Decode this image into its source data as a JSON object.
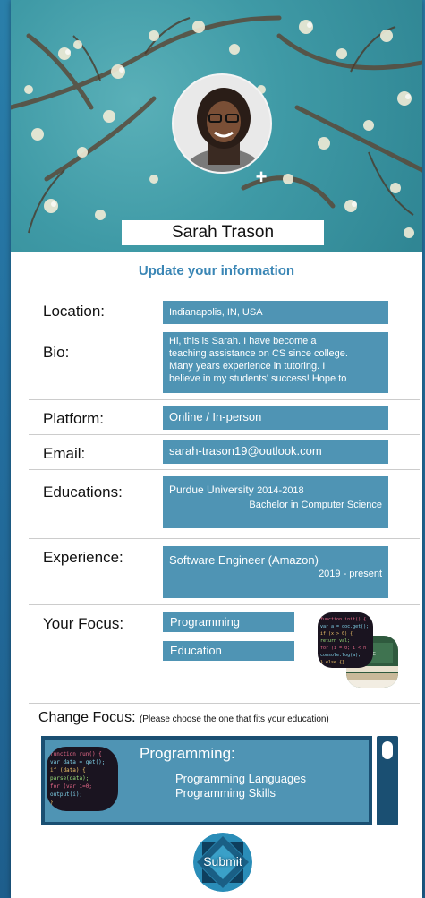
{
  "profile": {
    "name": "Sarah Trason",
    "add_photo_icon": "plus-icon"
  },
  "form": {
    "title": "Update your information",
    "location": {
      "label": "Location:",
      "value": "Indianapolis, IN, USA"
    },
    "bio": {
      "label": "Bio:",
      "lines": [
        "Hi, this is Sarah. I have become a",
        "teaching assistance on CS since college.",
        "Many years experience in tutoring. I",
        "believe in my students' success! Hope to"
      ]
    },
    "platform": {
      "label": "Platform:",
      "value": "Online / In-person"
    },
    "email": {
      "label": "Email:",
      "value": "sarah-trason19@outlook.com"
    },
    "education": {
      "label": "Educations:",
      "school": "Purdue University",
      "years": "2014-2018",
      "degree": "Bachelor in Computer Science"
    },
    "experience": {
      "label": "Experience:",
      "role": "Software Engineer (Amazon)",
      "period": "2019 - present"
    },
    "focus": {
      "label": "Your Focus:",
      "items": [
        "Programming",
        "Education"
      ]
    }
  },
  "change_focus": {
    "label": "Change Focus:",
    "hint": "(Please choose the one that fits your education)",
    "selected": {
      "title": "Programming:",
      "items": [
        "Programming Languages",
        "Programming Skills"
      ]
    }
  },
  "submit": {
    "label": "Submit"
  },
  "colors": {
    "field_bg": "#4f94b4",
    "accent": "#3a86b5",
    "panel_dark": "#1a4f72"
  }
}
